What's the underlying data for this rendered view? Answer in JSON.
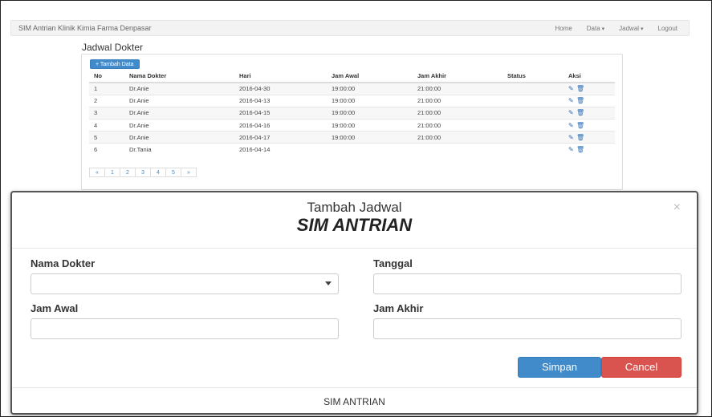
{
  "navbar": {
    "brand": "SIM Antrian Klinik Kimia Farma Denpasar",
    "items": [
      "Home",
      "Data",
      "Jadwal",
      "Logout"
    ]
  },
  "page": {
    "title": "Jadwal Dokter",
    "add_button": "+ Tambah Data"
  },
  "table": {
    "headers": [
      "No",
      "Nama Dokter",
      "Hari",
      "Jam Awal",
      "Jam Akhir",
      "Status",
      "Aksi"
    ],
    "rows": [
      [
        "1",
        "Dr.Anie",
        "2016-04-30",
        "19:00:00",
        "21:00:00",
        ""
      ],
      [
        "2",
        "Dr.Anie",
        "2016-04-13",
        "19:00:00",
        "21:00:00",
        ""
      ],
      [
        "3",
        "Dr.Anie",
        "2016-04-15",
        "19:00:00",
        "21:00:00",
        ""
      ],
      [
        "4",
        "Dr.Anie",
        "2016-04-16",
        "19:00:00",
        "21:00:00",
        ""
      ],
      [
        "5",
        "Dr.Anie",
        "2016-04-17",
        "19:00:00",
        "21:00:00",
        ""
      ],
      [
        "6",
        "Dr.Tania",
        "2016-04-14",
        "",
        "",
        ""
      ]
    ]
  },
  "pagination": [
    "«",
    "1",
    "2",
    "3",
    "4",
    "5",
    "»"
  ],
  "modal": {
    "title": "Tambah Jadwal",
    "subtitle": "SIM ANTRIAN",
    "close": "×",
    "fields": {
      "nama_dokter": {
        "label": "Nama Dokter",
        "value": ""
      },
      "tanggal": {
        "label": "Tanggal",
        "value": ""
      },
      "jam_awal": {
        "label": "Jam Awal",
        "value": ""
      },
      "jam_akhir": {
        "label": "Jam Akhir",
        "value": ""
      }
    },
    "save_label": "Simpan",
    "cancel_label": "Cancel",
    "footer": "SIM ANTRIAN"
  },
  "colors": {
    "primary": "#428bca",
    "danger": "#d9534f"
  }
}
